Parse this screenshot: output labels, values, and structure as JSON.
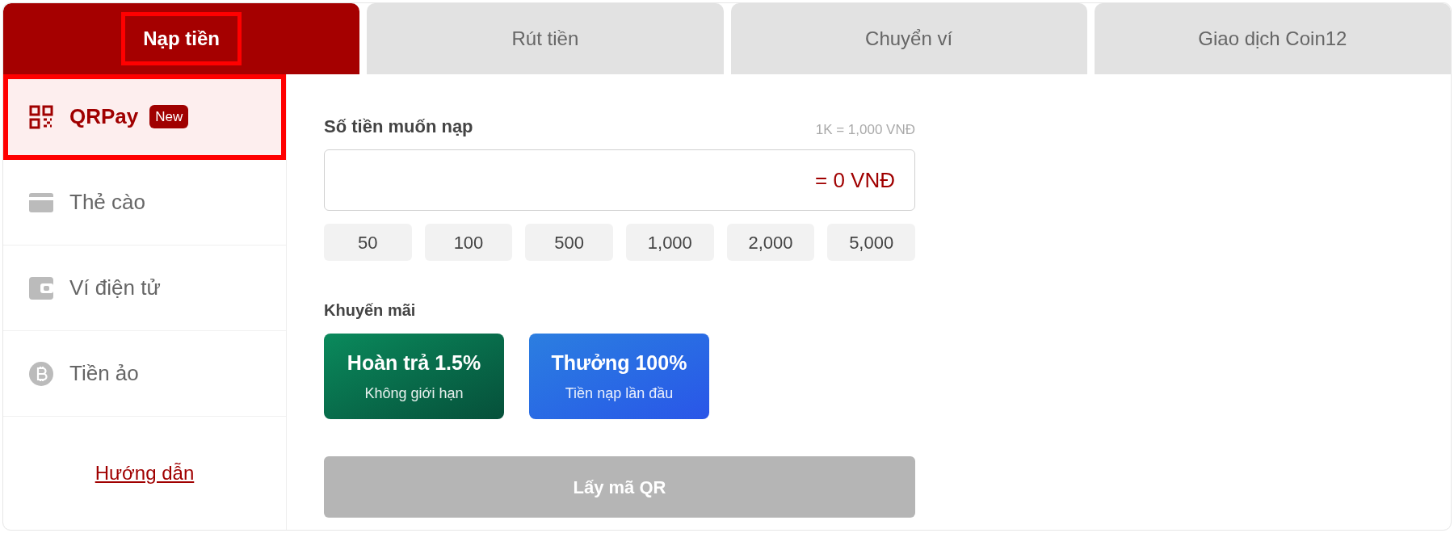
{
  "tabs": [
    {
      "label": "Nạp tiền",
      "selected": true,
      "highlighted": true
    },
    {
      "label": "Rút tiền",
      "selected": false,
      "highlighted": false
    },
    {
      "label": "Chuyển ví",
      "selected": false,
      "highlighted": false
    },
    {
      "label": "Giao dịch Coin12",
      "selected": false,
      "highlighted": false
    }
  ],
  "sidebar": {
    "items": [
      {
        "kind": "qr",
        "label": "QRPay",
        "badge": "New",
        "selected": true,
        "highlighted": true
      },
      {
        "kind": "card",
        "label": "Thẻ cào",
        "selected": false,
        "highlighted": false
      },
      {
        "kind": "wallet",
        "label": "Ví điện tử",
        "selected": false,
        "highlighted": false
      },
      {
        "kind": "coin",
        "label": "Tiền ảo",
        "selected": false,
        "highlighted": false
      }
    ],
    "help_link": "Hướng dẫn"
  },
  "amount": {
    "label": "Số tiền muốn nạp",
    "rate": "1K = 1,000 VNĐ",
    "conversion": "= 0 VNĐ",
    "presets": [
      "50",
      "100",
      "500",
      "1,000",
      "2,000",
      "5,000"
    ]
  },
  "promotions": {
    "label": "Khuyến mãi",
    "items": [
      {
        "kind": "green",
        "title": "Hoàn trả 1.5%",
        "subtitle": "Không giới hạn"
      },
      {
        "kind": "blue",
        "title": "Thưởng 100%",
        "subtitle": "Tiền nạp lần đầu"
      }
    ]
  },
  "submit": {
    "label": "Lấy mã QR",
    "disabled": true
  }
}
